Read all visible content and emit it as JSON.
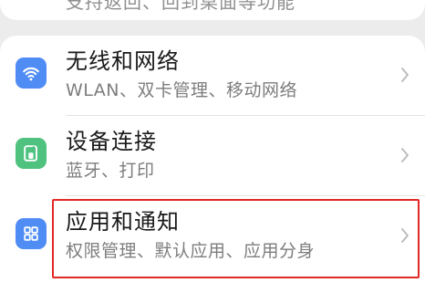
{
  "previous_item": {
    "subtitle": "支持返回、回到桌面等功能"
  },
  "settings": {
    "items": [
      {
        "title": "无线和网络",
        "subtitle": "WLAN、双卡管理、移动网络",
        "icon": "wifi-icon",
        "icon_color": "#4f8cf4"
      },
      {
        "title": "设备连接",
        "subtitle": "蓝牙、打印",
        "icon": "device-connection-icon",
        "icon_color": "#4fc27f"
      },
      {
        "title": "应用和通知",
        "subtitle": "权限管理、默认应用、应用分身",
        "icon": "apps-grid-icon",
        "icon_color": "#4f8cf4",
        "highlighted": true
      }
    ]
  },
  "highlight_color": "#e22727"
}
